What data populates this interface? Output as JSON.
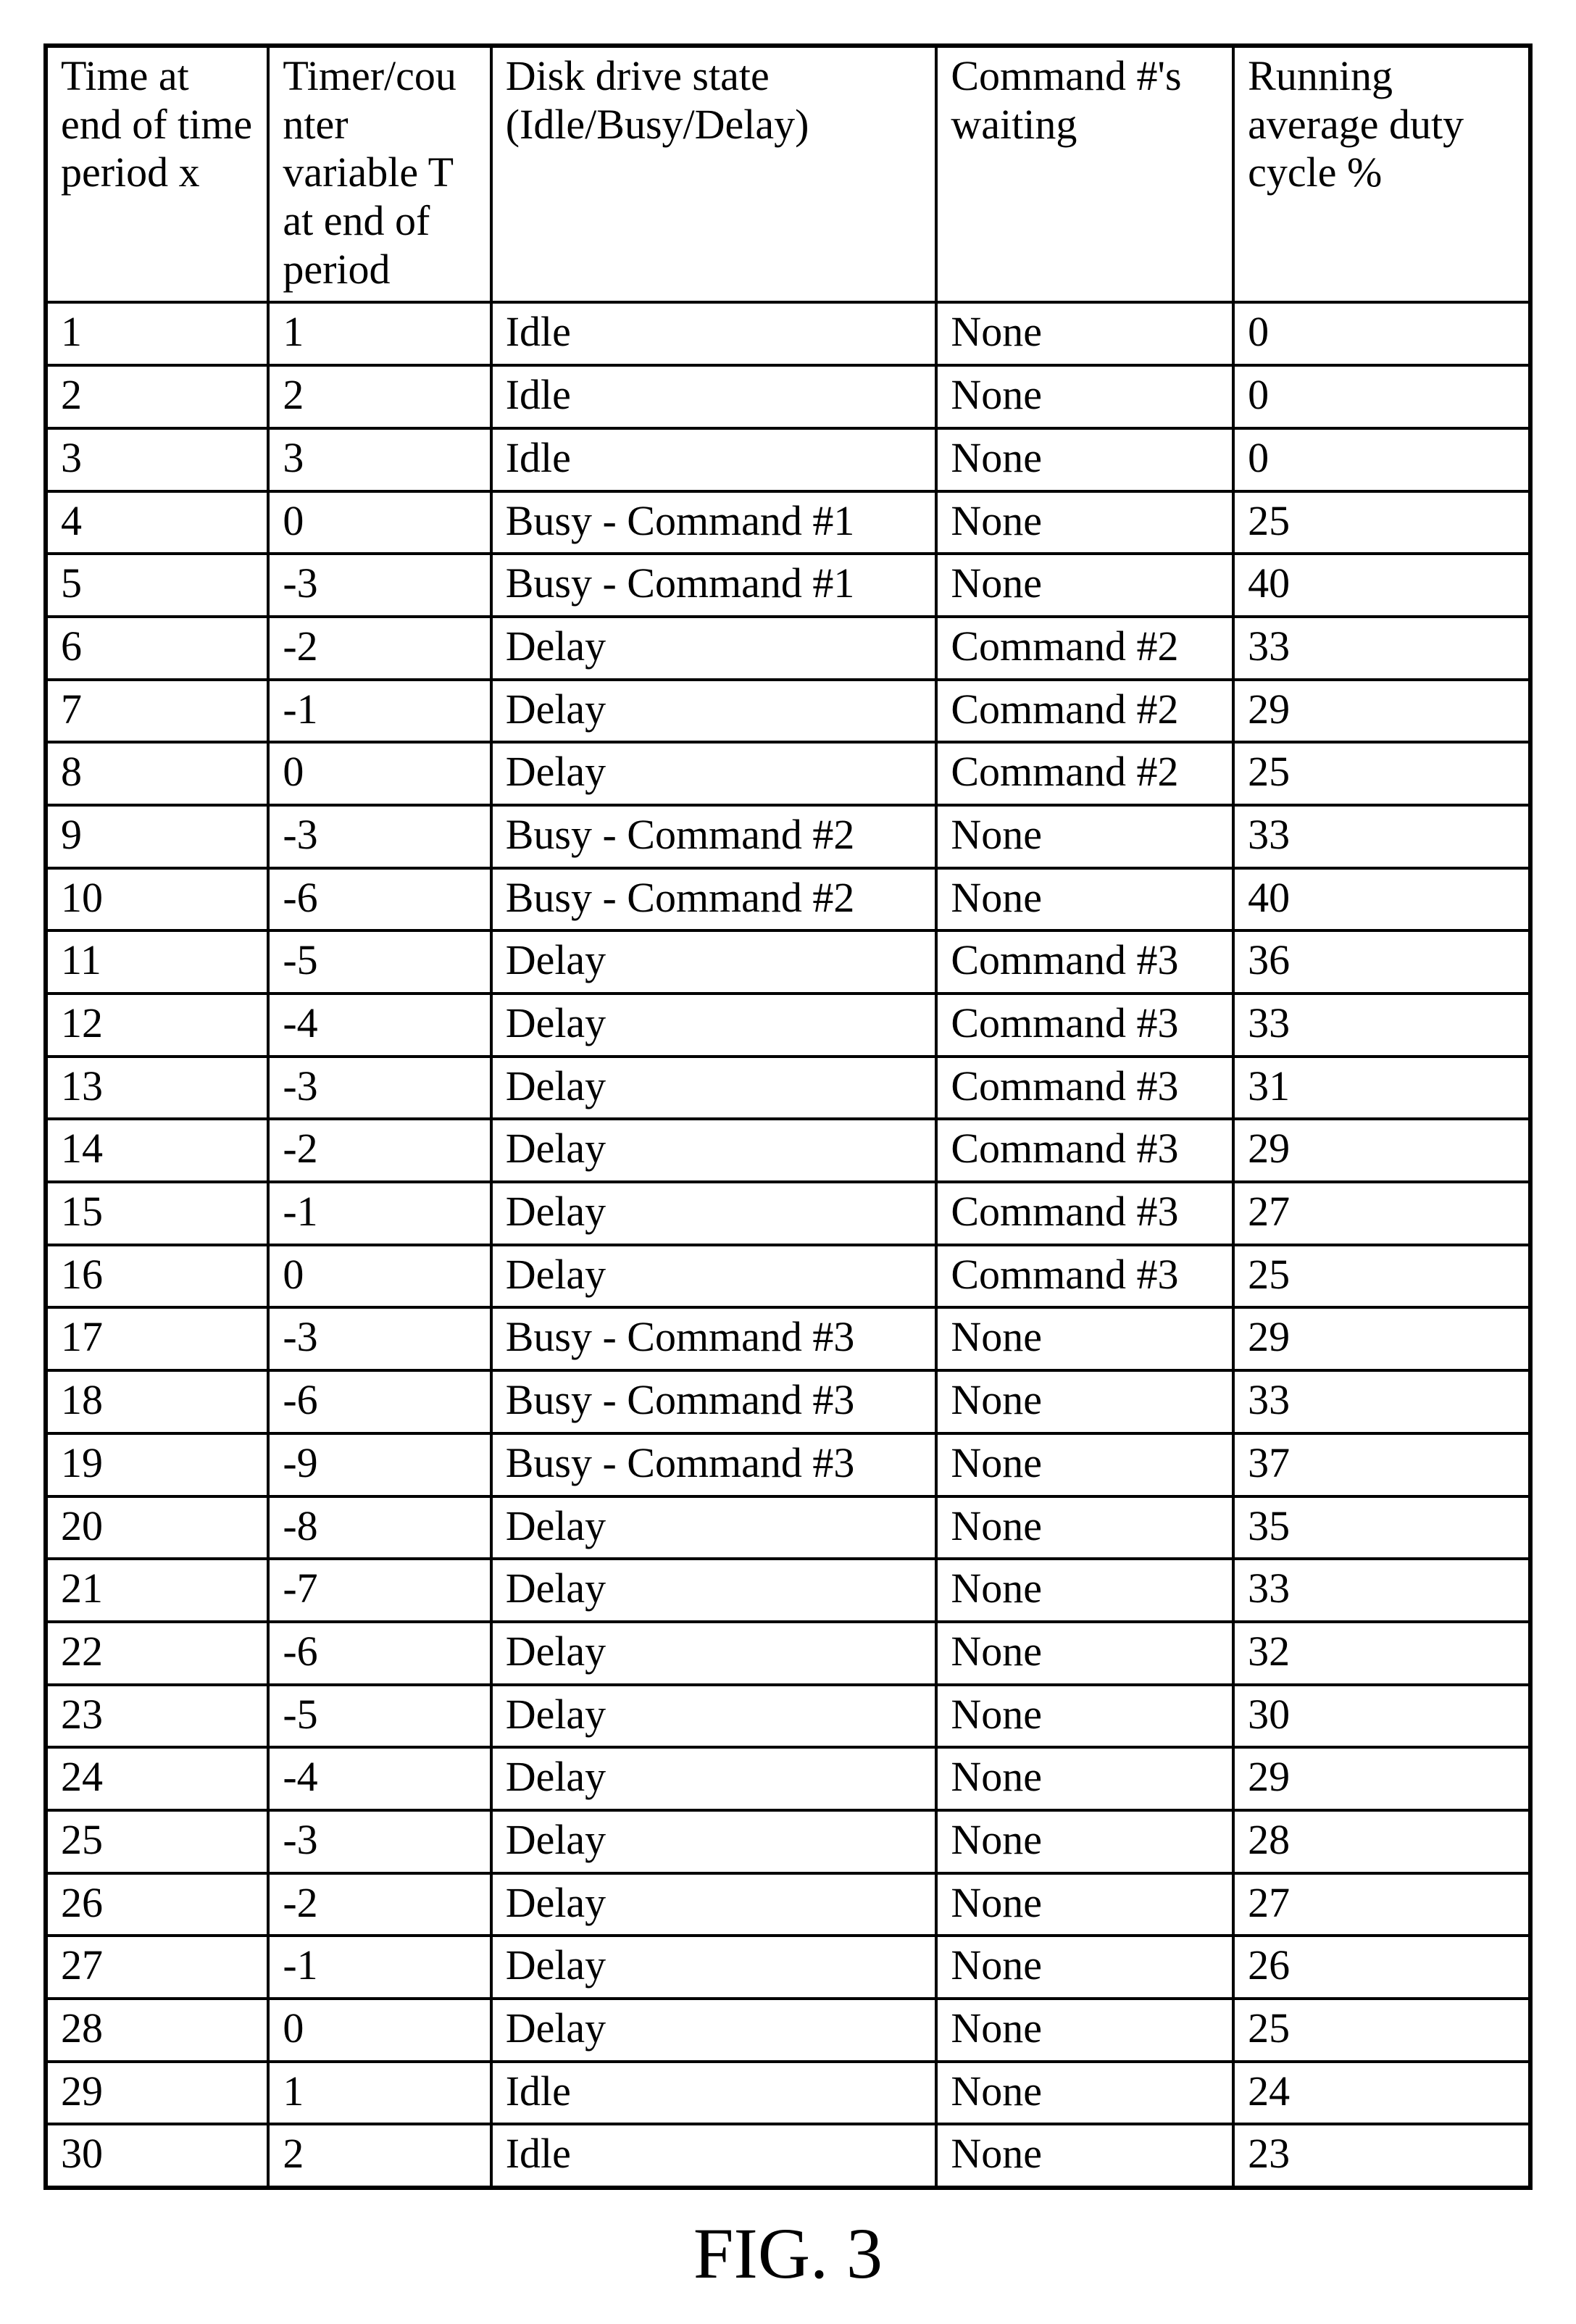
{
  "caption": "FIG. 3",
  "columns": [
    "Time at end of time period x",
    "Timer/counter variable T at end of period",
    "Disk drive state (Idle/Busy/Delay)",
    "Command #'s waiting",
    "Running average duty cycle %"
  ],
  "rows": [
    {
      "c": [
        "1",
        "1",
        "Idle",
        "None",
        "0"
      ]
    },
    {
      "c": [
        "2",
        "2",
        "Idle",
        "None",
        "0"
      ]
    },
    {
      "c": [
        "3",
        "3",
        "Idle",
        "None",
        "0"
      ]
    },
    {
      "c": [
        "4",
        "0",
        "Busy - Command #1",
        "None",
        "25"
      ]
    },
    {
      "c": [
        "5",
        "-3",
        "Busy - Command #1",
        "None",
        "40"
      ]
    },
    {
      "c": [
        "6",
        "-2",
        "Delay",
        "Command #2",
        "33"
      ]
    },
    {
      "c": [
        "7",
        "-1",
        "Delay",
        "Command #2",
        "29"
      ]
    },
    {
      "c": [
        "8",
        "0",
        "Delay",
        "Command #2",
        "25"
      ]
    },
    {
      "c": [
        "9",
        "-3",
        "Busy - Command #2",
        "None",
        "33"
      ]
    },
    {
      "c": [
        "10",
        "-6",
        "Busy - Command #2",
        "None",
        "40"
      ]
    },
    {
      "c": [
        "11",
        "-5",
        "Delay",
        "Command #3",
        "36"
      ]
    },
    {
      "c": [
        "12",
        "-4",
        "Delay",
        "Command #3",
        "33"
      ]
    },
    {
      "c": [
        "13",
        "-3",
        "Delay",
        "Command #3",
        "31"
      ]
    },
    {
      "c": [
        "14",
        "-2",
        "Delay",
        "Command #3",
        "29"
      ]
    },
    {
      "c": [
        "15",
        "-1",
        "Delay",
        "Command #3",
        "27"
      ]
    },
    {
      "c": [
        "16",
        "0",
        "Delay",
        "Command #3",
        "25"
      ]
    },
    {
      "c": [
        "17",
        "-3",
        "Busy - Command #3",
        "None",
        "29"
      ]
    },
    {
      "c": [
        "18",
        "-6",
        "Busy - Command #3",
        "None",
        "33"
      ]
    },
    {
      "c": [
        "19",
        "-9",
        "Busy - Command #3",
        "None",
        "37"
      ]
    },
    {
      "c": [
        "20",
        "-8",
        "Delay",
        "None",
        "35"
      ]
    },
    {
      "c": [
        "21",
        "-7",
        "Delay",
        "None",
        "33"
      ]
    },
    {
      "c": [
        "22",
        "-6",
        "Delay",
        "None",
        "32"
      ]
    },
    {
      "c": [
        "23",
        "-5",
        "Delay",
        "None",
        "30"
      ]
    },
    {
      "c": [
        "24",
        "-4",
        "Delay",
        "None",
        "29"
      ]
    },
    {
      "c": [
        "25",
        "-3",
        "Delay",
        "None",
        "28"
      ]
    },
    {
      "c": [
        "26",
        "-2",
        "Delay",
        "None",
        "27"
      ]
    },
    {
      "c": [
        "27",
        "-1",
        "Delay",
        "None",
        "26"
      ]
    },
    {
      "c": [
        "28",
        "0",
        "Delay",
        "None",
        "25"
      ]
    },
    {
      "c": [
        "29",
        "1",
        "Idle",
        "None",
        "24"
      ]
    },
    {
      "c": [
        "30",
        "2",
        "Idle",
        "None",
        "23"
      ]
    }
  ],
  "col_widths_percent": [
    15,
    15,
    30,
    20,
    20
  ]
}
